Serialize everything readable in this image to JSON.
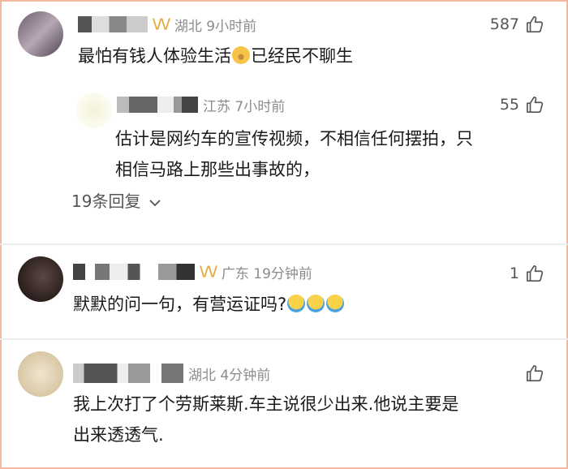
{
  "comments": [
    {
      "location": "湖北 9小时前",
      "likes": "587",
      "text_before": "最怕有钱人体验生活",
      "emoji1": "money-face-emoji",
      "text_after": "已经民不聊生",
      "reply": {
        "location": "江苏 7小时前",
        "likes": "55",
        "line1": "估计是网约车的宣传视频，不相信任何摆拍，只",
        "line2": "相信马路上那些出事故的，"
      },
      "more_replies": "19条回复"
    },
    {
      "location": "广东 19分钟前",
      "likes": "1",
      "text": "默默的问一句，有营运证吗?",
      "emoji": "laughing-crying-emoji"
    },
    {
      "location": "湖北 4分钟前",
      "line1": "我上次打了个劳斯莱斯.车主说很少出来.他说主要是",
      "line2": "出来透透气."
    }
  ],
  "colors": {
    "accent_vip": "#e3a93b",
    "meta_gray": "#8c8c8c",
    "border": "#f3b9a0"
  }
}
